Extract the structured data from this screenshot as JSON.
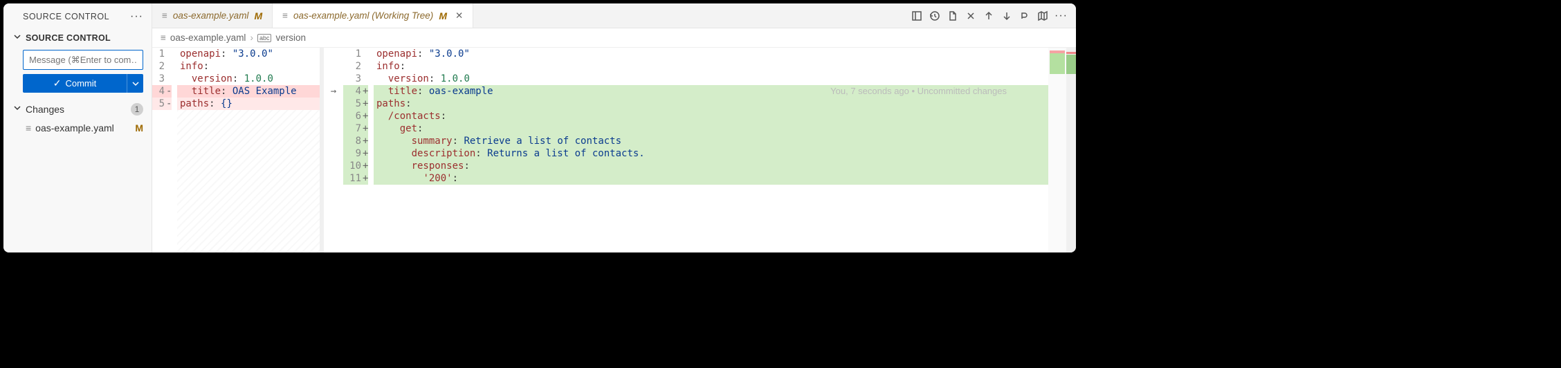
{
  "sidebar": {
    "title": "SOURCE CONTROL",
    "section_title": "SOURCE CONTROL",
    "commit_placeholder": "Message (⌘Enter to com…",
    "commit_button": "Commit",
    "changes_label": "Changes",
    "changes_count": "1",
    "files": [
      {
        "name": "oas-example.yaml",
        "status": "M"
      }
    ]
  },
  "tabs": [
    {
      "label": "oas-example.yaml",
      "status": "M",
      "active": false
    },
    {
      "label": "oas-example.yaml (Working Tree)",
      "status": "M",
      "active": true
    }
  ],
  "breadcrumb": {
    "file": "oas-example.yaml",
    "symbol": "version"
  },
  "blame": "You, 7 seconds ago • Uncommitted changes",
  "diff": {
    "left": [
      {
        "n": "1",
        "cls": "",
        "tokens": [
          [
            "yaml-key",
            "openapi"
          ],
          [
            "yaml-colon",
            ": "
          ],
          [
            "yaml-str",
            "\"3.0.0\""
          ]
        ]
      },
      {
        "n": "2",
        "cls": "",
        "tokens": [
          [
            "yaml-key",
            "info"
          ],
          [
            "yaml-colon",
            ":"
          ]
        ]
      },
      {
        "n": "3",
        "cls": "",
        "tokens": [
          [
            "",
            "  "
          ],
          [
            "yaml-key",
            "version"
          ],
          [
            "yaml-colon",
            ": "
          ],
          [
            "yaml-num",
            "1.0.0"
          ]
        ]
      },
      {
        "n": "4",
        "cls": "removed",
        "sign": "-",
        "tokens": [
          [
            "",
            "  "
          ],
          [
            "yaml-key",
            "title"
          ],
          [
            "yaml-colon",
            ": "
          ],
          [
            "yaml-plain",
            "OAS Example"
          ]
        ]
      },
      {
        "n": "5",
        "cls": "removed-light",
        "sign": "-",
        "tokens": [
          [
            "yaml-key",
            "paths"
          ],
          [
            "yaml-colon",
            ": "
          ],
          [
            "yaml-str",
            "{}"
          ]
        ]
      }
    ],
    "right": [
      {
        "n": "1",
        "cls": "",
        "tokens": [
          [
            "yaml-key",
            "openapi"
          ],
          [
            "yaml-colon",
            ": "
          ],
          [
            "yaml-str",
            "\"3.0.0\""
          ]
        ]
      },
      {
        "n": "2",
        "cls": "",
        "tokens": [
          [
            "yaml-key",
            "info"
          ],
          [
            "yaml-colon",
            ":"
          ]
        ]
      },
      {
        "n": "3",
        "cls": "",
        "tokens": [
          [
            "",
            "  "
          ],
          [
            "yaml-key",
            "version"
          ],
          [
            "yaml-colon",
            ": "
          ],
          [
            "yaml-num",
            "1.0.0"
          ]
        ]
      },
      {
        "n": "4",
        "cls": "added",
        "sign": "+",
        "active": true,
        "tokens": [
          [
            "",
            "  "
          ],
          [
            "yaml-key",
            "title"
          ],
          [
            "yaml-colon",
            ": "
          ],
          [
            "yaml-plain",
            "oas-example"
          ]
        ]
      },
      {
        "n": "5",
        "cls": "added",
        "sign": "+",
        "tokens": [
          [
            "yaml-key",
            "paths"
          ],
          [
            "yaml-colon",
            ":"
          ]
        ]
      },
      {
        "n": "6",
        "cls": "added",
        "sign": "+",
        "tokens": [
          [
            "",
            "  "
          ],
          [
            "yaml-key",
            "/contacts"
          ],
          [
            "yaml-colon",
            ":"
          ]
        ]
      },
      {
        "n": "7",
        "cls": "added",
        "sign": "+",
        "tokens": [
          [
            "",
            "    "
          ],
          [
            "yaml-key",
            "get"
          ],
          [
            "yaml-colon",
            ":"
          ]
        ]
      },
      {
        "n": "8",
        "cls": "added",
        "sign": "+",
        "tokens": [
          [
            "",
            "      "
          ],
          [
            "yaml-key",
            "summary"
          ],
          [
            "yaml-colon",
            ": "
          ],
          [
            "yaml-plain",
            "Retrieve a list of contacts"
          ]
        ]
      },
      {
        "n": "9",
        "cls": "added",
        "sign": "+",
        "tokens": [
          [
            "",
            "      "
          ],
          [
            "yaml-key",
            "description"
          ],
          [
            "yaml-colon",
            ": "
          ],
          [
            "yaml-plain",
            "Returns a list of contacts."
          ]
        ]
      },
      {
        "n": "10",
        "cls": "added",
        "sign": "+",
        "tokens": [
          [
            "",
            "      "
          ],
          [
            "yaml-key",
            "responses"
          ],
          [
            "yaml-colon",
            ":"
          ]
        ]
      },
      {
        "n": "11",
        "cls": "added",
        "sign": "+",
        "tokens": [
          [
            "",
            "        "
          ],
          [
            "yaml-key",
            "'200'"
          ],
          [
            "yaml-colon",
            ":"
          ]
        ]
      }
    ]
  }
}
